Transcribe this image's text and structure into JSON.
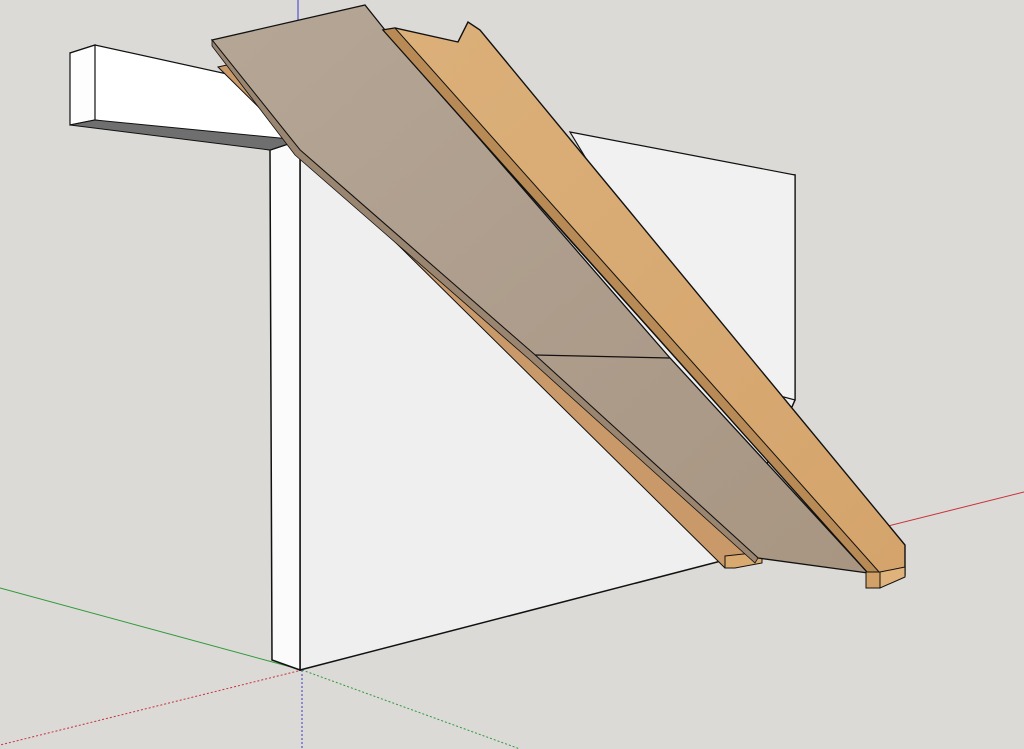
{
  "viewport": {
    "background": "#dbdad7",
    "axis_colors": {
      "red": "#c8323a",
      "green": "#2f9a3a",
      "blue": "#3a3ad0"
    }
  },
  "model": {
    "wall_face": "#efefef",
    "wall_side": "#fafafa",
    "wall_shadow": "#6f6f6f",
    "beam_top": "#ffffff",
    "stringer_face": "#d8aa72",
    "stringer_edge": "#b88a55",
    "tread_face": "#b3a394",
    "tread_edge": "#9a8570",
    "edge": "#111111"
  }
}
